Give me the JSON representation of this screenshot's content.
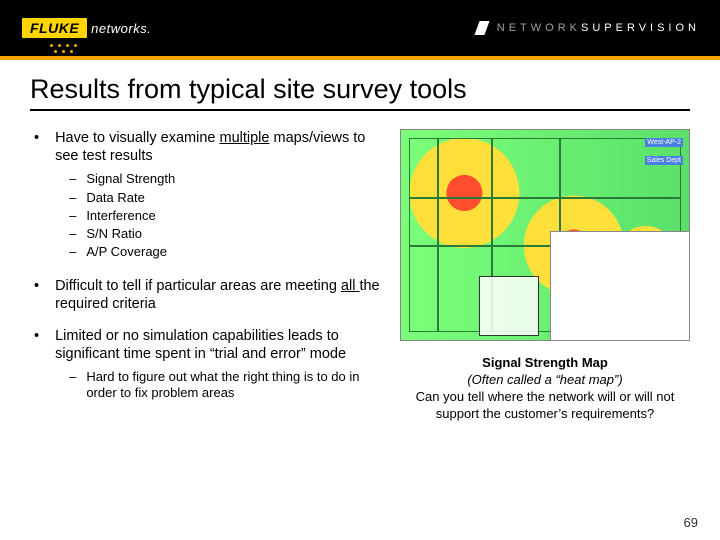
{
  "header": {
    "logo_brand": "FLUKE",
    "logo_sub": "networks.",
    "tag_left": "NETWORK",
    "tag_right": "SUPERVISION"
  },
  "title": "Results from typical site survey tools",
  "bullets": {
    "b1a": "Have to visually examine ",
    "b1u": "multiple",
    "b1b": " maps/views to see test results",
    "sub": {
      "s1": "Signal Strength",
      "s2": "Data Rate",
      "s3": "Interference",
      "s4": "S/N Ratio",
      "s5": "A/P Coverage"
    },
    "b2a": "Difficult to tell if particular areas are meeting ",
    "b2u": "all ",
    "b2b": "the required criteria",
    "b3": "Limited or no simulation capabilities leads to significant time spent in “trial and error” mode",
    "b3s": "Hard to figure out what the right thing is to do in order to fix problem areas"
  },
  "caption": {
    "c1": "Signal Strength Map",
    "c2": "(Often called a “heat map”)",
    "c3": "Can you tell where the network will or will not support the customer’s requirements?"
  },
  "page": "69"
}
